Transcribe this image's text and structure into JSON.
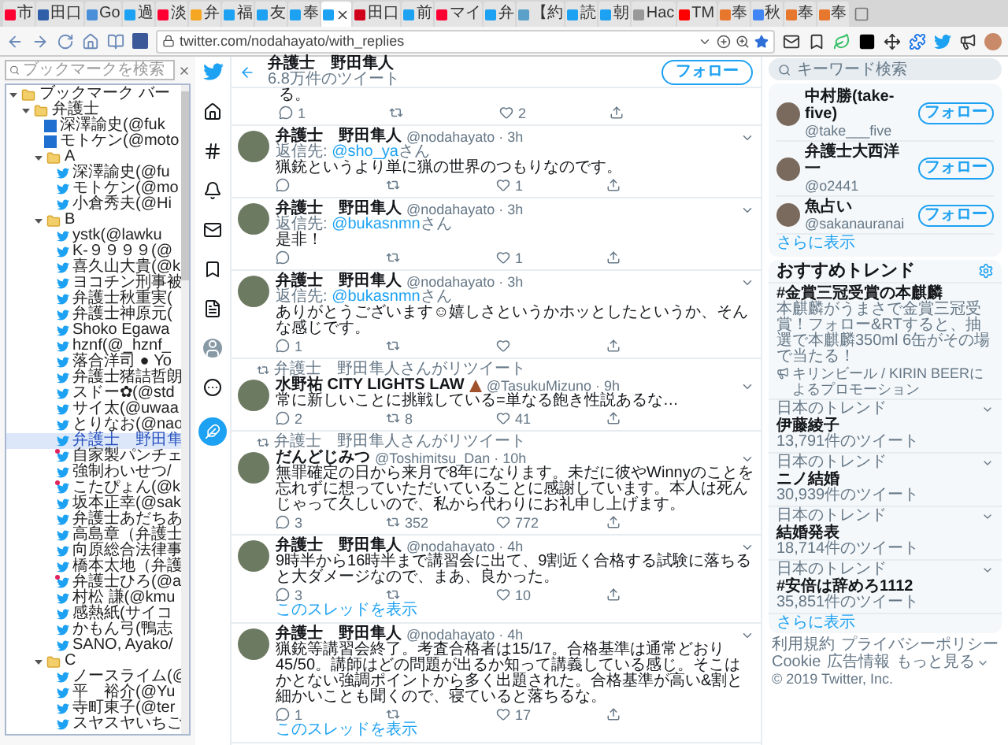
{
  "browser": {
    "tabs": [
      {
        "label": "市",
        "color": "#ff0033",
        "selected": false
      },
      {
        "label": "田口",
        "color": "#2f5fa8",
        "selected": false
      },
      {
        "label": "Go",
        "color": "#4a90d9",
        "selected": false
      },
      {
        "label": "過",
        "color": "#1da1f2",
        "selected": false
      },
      {
        "label": "淡",
        "color": "#ff0033",
        "selected": false
      },
      {
        "label": "弁",
        "color": "#f5a623",
        "selected": false
      },
      {
        "label": "福",
        "color": "#1da1f2",
        "selected": false
      },
      {
        "label": "友",
        "color": "#1da1f2",
        "selected": false
      },
      {
        "label": "奉",
        "color": "#1da1f2",
        "selected": false
      },
      {
        "color": "#1da1f2",
        "selected": true
      },
      {
        "label": "田口",
        "color": "#d0021b",
        "selected": false
      },
      {
        "label": "前",
        "color": "#1da1f2",
        "selected": false
      },
      {
        "label": "マイ",
        "color": "#ff0033",
        "selected": false
      },
      {
        "label": "弁",
        "color": "#1da1f2",
        "selected": false
      },
      {
        "label": "【約",
        "color": "#5aa0c8",
        "selected": false
      },
      {
        "label": "読",
        "color": "#1da1f2",
        "selected": false
      },
      {
        "label": "朝",
        "color": "#1da1f2",
        "selected": false
      },
      {
        "label": "Hac",
        "color": "#999999",
        "selected": false
      },
      {
        "label": "TM",
        "color": "#ff0000",
        "selected": false
      },
      {
        "label": "奉",
        "color": "#e8772e",
        "selected": false
      },
      {
        "label": "秋",
        "color": "#4285f4",
        "selected": false
      },
      {
        "label": "奉",
        "color": "#e8772e",
        "selected": false
      },
      {
        "label": "奉",
        "color": "#e8772e",
        "selected": false
      }
    ],
    "url": "twitter.com/nodahayato/with_replies"
  },
  "bookmarks_panel": {
    "search_placeholder": "ブックマークを検索",
    "tree": [
      {
        "kind": "folder",
        "label": "ブックマーク バー",
        "expanded": true,
        "selected": false,
        "children": [
          {
            "kind": "folder",
            "label": "弁護士",
            "expanded": true,
            "selected": false,
            "children": [
              {
                "kind": "page",
                "label": "深澤諭史(@fuk",
                "selected": false
              },
              {
                "kind": "page",
                "label": "モトケン(@moto",
                "selected": false
              },
              {
                "kind": "folder",
                "label": "A",
                "expanded": true,
                "selected": false,
                "children": [
                  {
                    "kind": "twitter",
                    "label": "深澤諭史(@fu",
                    "selected": false,
                    "new": false
                  },
                  {
                    "kind": "twitter",
                    "label": "モトケン(@mo",
                    "selected": false,
                    "new": false
                  },
                  {
                    "kind": "twitter",
                    "label": "小倉秀夫(@Hi",
                    "selected": false,
                    "new": false
                  }
                ]
              },
              {
                "kind": "folder",
                "label": "B",
                "expanded": true,
                "selected": false,
                "children": [
                  {
                    "kind": "twitter",
                    "label": "ystk(@lawku",
                    "selected": false,
                    "new": false
                  },
                  {
                    "kind": "twitter",
                    "label": "K-９９９９(@",
                    "selected": false,
                    "new": false
                  },
                  {
                    "kind": "twitter",
                    "label": "喜久山大貴(@k",
                    "selected": false,
                    "new": false
                  },
                  {
                    "kind": "twitter",
                    "label": "ヨコチン刑事被",
                    "selected": false,
                    "new": false
                  },
                  {
                    "kind": "twitter",
                    "label": "弁護士秋重実(",
                    "selected": false,
                    "new": false
                  },
                  {
                    "kind": "twitter",
                    "label": "弁護士神原元(",
                    "selected": false,
                    "new": false
                  },
                  {
                    "kind": "twitter",
                    "label": "Shoko Egawa",
                    "selected": false,
                    "new": false
                  },
                  {
                    "kind": "twitter",
                    "label": "hznf(@_hznf_",
                    "selected": false,
                    "new": false
                  },
                  {
                    "kind": "twitter",
                    "label": "落合洋司 ● Yo",
                    "selected": false,
                    "new": false
                  },
                  {
                    "kind": "twitter",
                    "label": "弁護士猪詰哲朗",
                    "selected": false,
                    "new": false
                  },
                  {
                    "kind": "twitter",
                    "label": "スドー✿(@std",
                    "selected": false,
                    "new": false
                  },
                  {
                    "kind": "twitter",
                    "label": "サイ太(@uwaa",
                    "selected": false,
                    "new": false
                  },
                  {
                    "kind": "twitter",
                    "label": "とりなお(@nao",
                    "selected": false,
                    "new": false
                  },
                  {
                    "kind": "twitter",
                    "label": "弁護士　野田隼",
                    "selected": true,
                    "new": false
                  },
                  {
                    "kind": "twitter",
                    "label": "自家製パンチェ",
                    "selected": false,
                    "new": true
                  },
                  {
                    "kind": "twitter",
                    "label": "強制わいせつ/",
                    "selected": false,
                    "new": false
                  },
                  {
                    "kind": "twitter",
                    "label": "こたぴょん(@k",
                    "selected": false,
                    "new": true
                  },
                  {
                    "kind": "twitter",
                    "label": "坂本正幸(@sak",
                    "selected": false,
                    "new": false
                  },
                  {
                    "kind": "twitter",
                    "label": "弁護士あだちあ",
                    "selected": false,
                    "new": false
                  },
                  {
                    "kind": "twitter",
                    "label": "高島章（弁護士",
                    "selected": false,
                    "new": false
                  },
                  {
                    "kind": "twitter",
                    "label": "向原総合法律事",
                    "selected": false,
                    "new": false
                  },
                  {
                    "kind": "twitter",
                    "label": "橋本太地（弁護",
                    "selected": false,
                    "new": false
                  },
                  {
                    "kind": "twitter",
                    "label": "弁護士ひろ(@a",
                    "selected": false,
                    "new": true
                  },
                  {
                    "kind": "twitter",
                    "label": "村松 謙(@kmu",
                    "selected": false,
                    "new": false
                  },
                  {
                    "kind": "twitter",
                    "label": "感熱紙(サイコ",
                    "selected": false,
                    "new": false
                  },
                  {
                    "kind": "twitter",
                    "label": "かもん弓(鴨志",
                    "selected": false,
                    "new": false
                  },
                  {
                    "kind": "twitter",
                    "label": "SANO, Ayako/",
                    "selected": false,
                    "new": false
                  }
                ]
              },
              {
                "kind": "folder",
                "label": "C",
                "expanded": true,
                "selected": false,
                "children": [
                  {
                    "kind": "twitter",
                    "label": "ノースライム(@",
                    "selected": false,
                    "new": false
                  },
                  {
                    "kind": "twitter",
                    "label": "平　裕介(@Yu",
                    "selected": false,
                    "new": false
                  },
                  {
                    "kind": "twitter",
                    "label": "寺町東子(@ter",
                    "selected": false,
                    "new": false
                  },
                  {
                    "kind": "twitter",
                    "label": "スヤスヤいちご",
                    "selected": false,
                    "new": false
                  }
                ]
              }
            ]
          }
        ]
      }
    ]
  },
  "profile_header": {
    "name": "弁護士　野田隼人",
    "tweet_count": "6.8万件のツイート",
    "follow_button": "フォロー"
  },
  "timeline": [
    {
      "kind": "partial",
      "text": "る。",
      "replies": "1",
      "likes": "2"
    },
    {
      "kind": "tweet",
      "name": "弁護士　野田隼人",
      "meta": "@nodahayato · 3h",
      "reply_to": {
        "prefix": "返信先: ",
        "user": "@sho_ya",
        "suffix": "さん"
      },
      "text": "猟銃というより単に猟の世界のつもりなのです。",
      "likes": "1"
    },
    {
      "kind": "tweet",
      "name": "弁護士　野田隼人",
      "meta": "@nodahayato · 3h",
      "reply_to": {
        "prefix": "返信先: ",
        "user": "@bukasnmn",
        "suffix": "さん"
      },
      "text": "是非！",
      "likes": "1"
    },
    {
      "kind": "tweet",
      "name": "弁護士　野田隼人",
      "meta": "@nodahayato · 3h",
      "reply_to": {
        "prefix": "返信先: ",
        "user": "@bukasnmn",
        "suffix": "さん"
      },
      "text": "ありがとうございます☺嬉しさというかホッとしたというか、そんな感じです。",
      "replies": "1"
    },
    {
      "kind": "tweet",
      "retweeted_by": "弁護士　野田隼人さんがリツイート",
      "name": "水野祐 CITY LIGHTS LAW",
      "name_icon": true,
      "meta": "@TasukuMizuno · 9h",
      "text": "常に新しいことに挑戦している=単なる飽き性説あるな…",
      "replies": "2",
      "retweets": "8",
      "likes": "41"
    },
    {
      "kind": "tweet",
      "retweeted_by": "弁護士　野田隼人さんがリツイート",
      "name": "だんどじみつ",
      "meta": "@Toshimitsu_Dan · 10h",
      "text": "無罪確定の日から来月で8年になります。未だに彼やWinnyのことを忘れずに想っていただいていることに感謝しています。本人は死んじゃって久しいので、私から代わりにお礼申し上げます。",
      "replies": "3",
      "retweets": "352",
      "likes": "772"
    },
    {
      "kind": "tweet",
      "name": "弁護士　野田隼人",
      "meta": "@nodahayato · 4h",
      "text": "9時半から16時半まで講習会に出て、9割近く合格する試験に落ちると大ダメージなので、まあ、良かった。",
      "replies": "3",
      "likes": "10",
      "show_thread": "このスレッドを表示"
    },
    {
      "kind": "tweet",
      "name": "弁護士　野田隼人",
      "meta": "@nodahayato · 4h",
      "text": "猟銃等講習会終了。考査合格者は15/17。合格基準は通常どおり45/50。講師はどの問題が出るか知って講義している感じ。そこはかとない強調ポイントから多く出題された。合格基準が高い&割と細かいことも聞くので、寝ていると落ちるな。",
      "replies": "1",
      "likes": "17",
      "show_thread": "このスレッドを表示"
    }
  ],
  "right_column": {
    "search": {
      "placeholder": "キーワード検索"
    },
    "who_to_follow": {
      "users": [
        {
          "name": "中村勝(take-five)",
          "handle": "@take___five",
          "button": "フォロー"
        },
        {
          "name": "弁護士大西洋一",
          "handle": "@o2441",
          "button": "フォロー"
        },
        {
          "name": "魚占い",
          "handle": "@sakanauranai",
          "button": "フォロー"
        }
      ],
      "more": "さらに表示"
    },
    "trends": {
      "title": "おすすめトレンド",
      "promoted": {
        "name": "#金賞三冠受賞の本麒麟",
        "description": "本麒麟がうまさで金賞三冠受賞！フォロー&RTすると、抽選で本麒麟350ml 6缶がその場で当たる！",
        "promoter": "キリンビール / KIRIN BEERによるプロモーション"
      },
      "items": [
        {
          "context": "日本のトレンド",
          "name": "伊藤綾子",
          "count": "13,791件のツイート"
        },
        {
          "context": "日本のトレンド",
          "name": "ニノ結婚",
          "count": "30,939件のツイート"
        },
        {
          "context": "日本のトレンド",
          "name": "結婚発表",
          "count": "18,714件のツイート"
        },
        {
          "context": "日本のトレンド",
          "name": "#安倍は辞めろ1112",
          "count": "35,851件のツイート"
        }
      ],
      "more": "さらに表示"
    },
    "footer": {
      "links": [
        "利用規約",
        "プライバシーポリシー",
        "Cookie",
        "広告情報"
      ],
      "more": "もっと見る",
      "copyright": "© 2019 Twitter, Inc."
    }
  }
}
